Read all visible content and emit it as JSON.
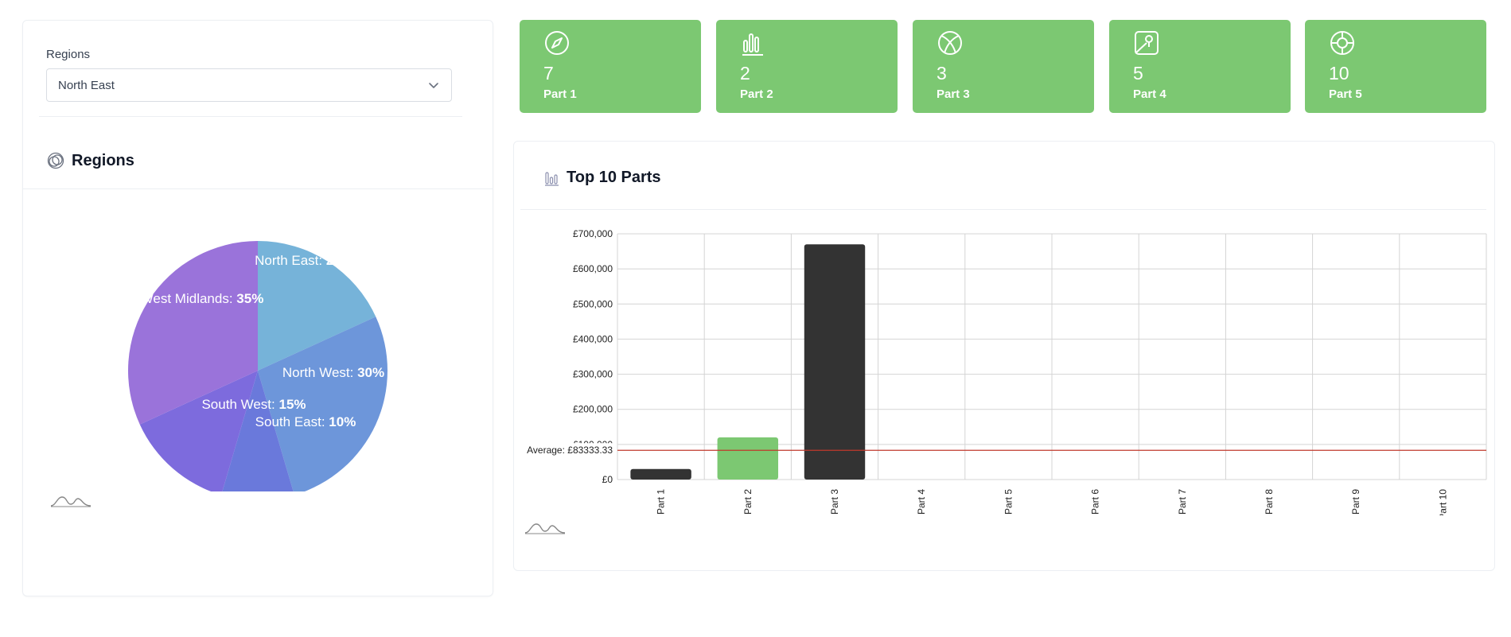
{
  "filter": {
    "label": "Regions",
    "selected": "North East"
  },
  "pie_panel": {
    "title": "Regions"
  },
  "tiles": [
    {
      "value": "7",
      "label": "Part 1",
      "icon": "compass-icon"
    },
    {
      "value": "2",
      "label": "Part 2",
      "icon": "bar-chart-icon"
    },
    {
      "value": "3",
      "label": "Part 3",
      "icon": "ball-icon"
    },
    {
      "value": "5",
      "label": "Part 4",
      "icon": "map-pin-icon"
    },
    {
      "value": "10",
      "label": "Part 5",
      "icon": "lifebuoy-icon"
    }
  ],
  "bar_panel": {
    "title": "Top 10 Parts"
  },
  "colors": {
    "tile": "#7cc872",
    "bar_default": "#333333",
    "bar_highlight": "#7cc872",
    "average_line": "#c0392b"
  },
  "chart_data": [
    {
      "type": "pie",
      "title": "Regions",
      "slices": [
        {
          "label": "North East",
          "value": 20,
          "color": "#76b3d9"
        },
        {
          "label": "North West",
          "value": 30,
          "color": "#6d96da"
        },
        {
          "label": "South East",
          "value": 10,
          "color": "#6a79db"
        },
        {
          "label": "South West",
          "value": 15,
          "color": "#7d6bdd"
        },
        {
          "label": "West Midlands",
          "value": 35,
          "color": "#9a73da"
        }
      ]
    },
    {
      "type": "bar",
      "title": "Top 10 Parts",
      "categories": [
        "Part 1",
        "Part 2",
        "Part 3",
        "Part 4",
        "Part 5",
        "Part 6",
        "Part 7",
        "Part 8",
        "Part 9",
        "Part 10"
      ],
      "values": [
        30000,
        120000,
        670000,
        0,
        0,
        0,
        0,
        0,
        0,
        0
      ],
      "highlight_index": 1,
      "ylim": [
        0,
        700000
      ],
      "yticks": [
        "£0",
        "£100,000",
        "£200,000",
        "£300,000",
        "£400,000",
        "£500,000",
        "£600,000",
        "£700,000"
      ],
      "average_label": "Average: £83333.33",
      "average_value": 83333.33,
      "grid": true
    }
  ]
}
